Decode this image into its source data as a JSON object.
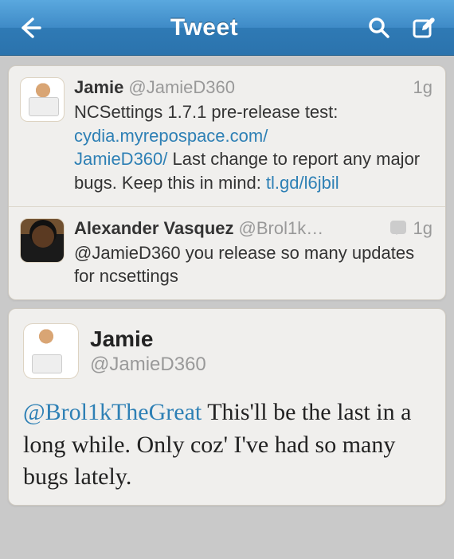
{
  "header": {
    "title": "Tweet"
  },
  "thread": [
    {
      "name": "Jamie",
      "handle": "@JamieD360",
      "time": "1g",
      "avatar": "j",
      "has_reply_icon": false,
      "segments": [
        {
          "t": "NCSettings 1.7.1 pre-release test: ",
          "link": false
        },
        {
          "t": "cydia.myrepospace.com/",
          "link": true,
          "br": true
        },
        {
          "t": "JamieD360/",
          "link": true
        },
        {
          "t": " Last change to report any major bugs. Keep this in mind: ",
          "link": false
        },
        {
          "t": "tl.gd/l6jbil",
          "link": true
        }
      ]
    },
    {
      "name": "Alexander Vasquez",
      "handle": "@Brol1k…",
      "time": "1g",
      "avatar": "a",
      "has_reply_icon": true,
      "segments": [
        {
          "t": "@JamieD360 you release so many updates for ncsettings",
          "link": false
        }
      ]
    }
  ],
  "detail": {
    "name": "Jamie",
    "handle": "@JamieD360",
    "avatar": "j",
    "segments": [
      {
        "t": "@Brol1kTheGreat",
        "link": true
      },
      {
        "t": " This'll be the last in a long while. Only coz' I've had so many bugs lately.",
        "link": false
      }
    ]
  }
}
